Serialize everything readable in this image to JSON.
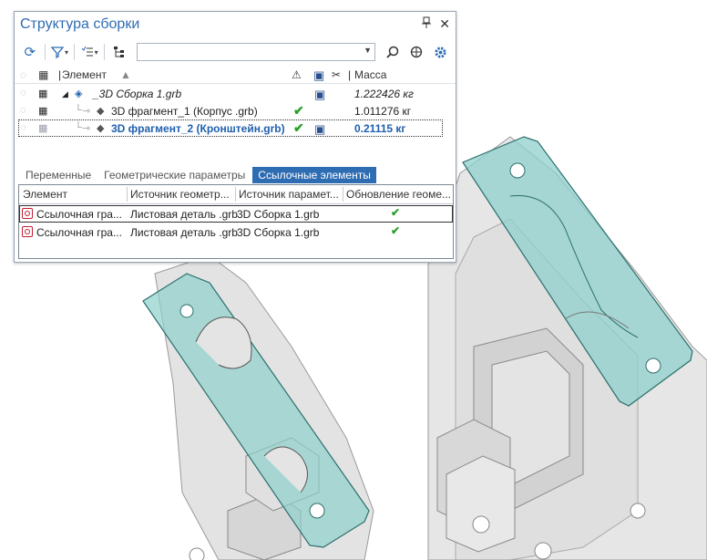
{
  "panel": {
    "title": "Структура сборки",
    "pin_glyph": "ᵽ",
    "close_glyph": "✕"
  },
  "toolbar": {
    "search_value": "",
    "buttons": [
      "refresh-icon",
      "filter-icon",
      "list-options-icon",
      "tree-structure-icon"
    ],
    "right_buttons": [
      "search-icon",
      "target-icon",
      "gear-icon"
    ]
  },
  "tree": {
    "headers": {
      "element": "Элемент",
      "mass": "Масса"
    },
    "rows": [
      {
        "name": "_3D Сборка 1.grb",
        "mass": "1.222426 кг",
        "italic": true,
        "check": "",
        "disk": "▣"
      },
      {
        "name": "3D фрагмент_1 (Корпус .grb)",
        "mass": "1.011276 кг",
        "italic": false,
        "check": "✔",
        "disk": ""
      },
      {
        "name": "3D фрагмент_2 (Кронштейн.grb)",
        "mass": "0.21115 кг",
        "bold": true,
        "check": "✔",
        "disk": "▣"
      }
    ]
  },
  "tabs": [
    {
      "label": "Переменные",
      "active": false
    },
    {
      "label": "Геометрические параметры",
      "active": false
    },
    {
      "label": "Ссылочные элементы",
      "active": true
    }
  ],
  "grid": {
    "headers": [
      "Элемент",
      "Источник геометр...",
      "Источник парамет...",
      "Обновление геоме..."
    ],
    "rows": [
      {
        "element": "Ссылочная гра...",
        "geom_source": "Листовая деталь .grb",
        "param_source": "3D Сборка 1.grb",
        "update": "✔"
      },
      {
        "element": "Ссылочная гра...",
        "geom_source": "Листовая деталь .grb",
        "param_source": "3D Сборка 1.grb",
        "update": "✔"
      }
    ]
  },
  "colors": {
    "accent": "#2f6db3",
    "check": "#2aa02a",
    "teal_part": "#8fd0cc"
  }
}
